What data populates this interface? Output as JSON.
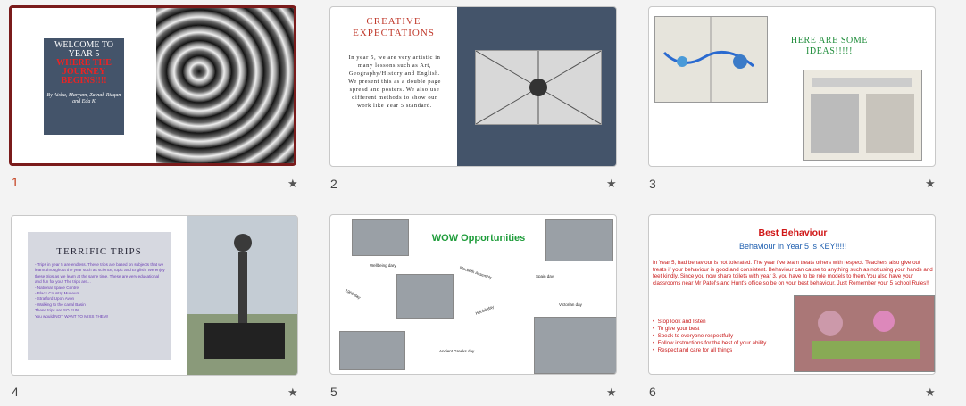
{
  "slides": [
    {
      "number": "1",
      "title_line1": "WELCOME TO YEAR 5",
      "title_line2": "WHERE THE JOURNEY BEGINS!!!!",
      "byline": "By Aisha, Maryam, Zainab Rizqan and Eda K"
    },
    {
      "number": "2",
      "title": "CREATIVE EXPECTATIONS",
      "body": "In year 5, we are very artistic in many lessons such as Art, Geography/History and English. We present this as a double page spread and posters. We also use different methods to show our work like Year 5 standard."
    },
    {
      "number": "3",
      "title": "HERE ARE SOME IDEAS!!!!!"
    },
    {
      "number": "4",
      "title": "TERRIFIC TRIPS",
      "intro": "- Trips in year 5 are endless. These trips are based on subjects that we learnt throughout the year such as science, topic and English. We enjoy these trips as we learn at the same time. These are very educational and fun for you! The trips are...",
      "items": [
        "- National Space Centre",
        "- Black Country Museum",
        "- Stratford Upon Avon",
        "- Walking to the canal Basin"
      ],
      "outro1": "These trips are SO FUN",
      "outro2": "You would NOT WANT TO MISS THEM!"
    },
    {
      "number": "5",
      "title": "WOW Opportunities",
      "labels": [
        "Wellbeing dary",
        "Macbeth Assembly",
        "Spain day",
        "1960 day",
        "Hobbit day",
        "Victorian day",
        "Ancient Greeks day"
      ]
    },
    {
      "number": "6",
      "title": "Best Behaviour",
      "subtitle": "Behaviour in Year 5 is KEY!!!!!",
      "paragraph": "In Year 5, bad behaviour is not tolerated. The year five team treats others with respect. Teachers also give out treats if your behaviour is good and consistent. Behaviour can cause to anything such as not using your hands and feet kindly. Since you now share toilets with year 3, you have to be role models to them.You also have your classrooms near Mr Patel's and Hunt's office so be on your best behaviour. Just Remember your 5 school Rules!!",
      "rules": [
        "Stop look and listen",
        "To give your best",
        "Speak to everyone respectfully",
        "Follow instructions for the best of your ability",
        "Respect and care for all things"
      ]
    }
  ],
  "star_symbol": "★"
}
